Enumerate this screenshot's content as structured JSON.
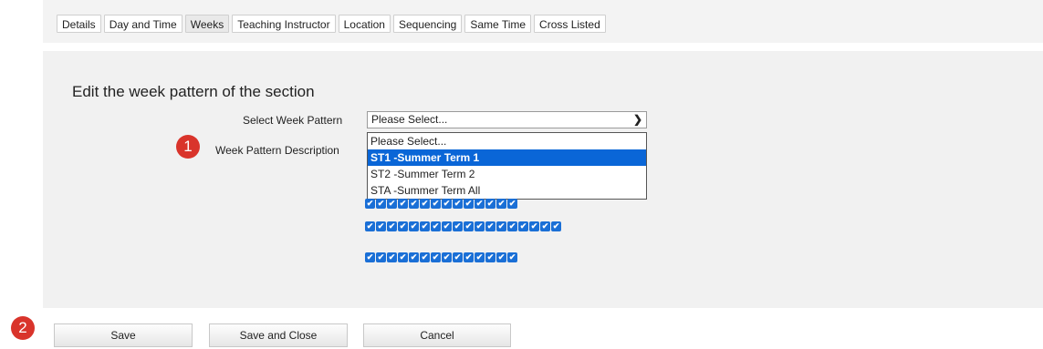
{
  "tabs": [
    "Details",
    "Day and Time",
    "Weeks",
    "Teaching Instructor",
    "Location",
    "Sequencing",
    "Same Time",
    "Cross Listed"
  ],
  "heading": "Edit the week pattern of the section",
  "select_label": "Select Week Pattern",
  "select_value": "Please Select...",
  "description_label": "Week Pattern Description",
  "dropdown_options": [
    "Please Select...",
    "ST1 -Summer Term 1",
    "ST2 -Summer Term 2",
    "STA -Summer Term All"
  ],
  "badges": [
    "1",
    "2"
  ],
  "checkbox_rows": [
    14,
    18,
    14
  ],
  "buttons": {
    "save": "Save",
    "save_close": "Save and Close",
    "cancel": "Cancel"
  },
  "colors": {
    "highlight": "#0a66d7",
    "checkbox": "#1a6fd6",
    "badge": "#d9342b"
  },
  "icons": {
    "chevron": "chevron-down-icon",
    "check": "check-icon"
  }
}
